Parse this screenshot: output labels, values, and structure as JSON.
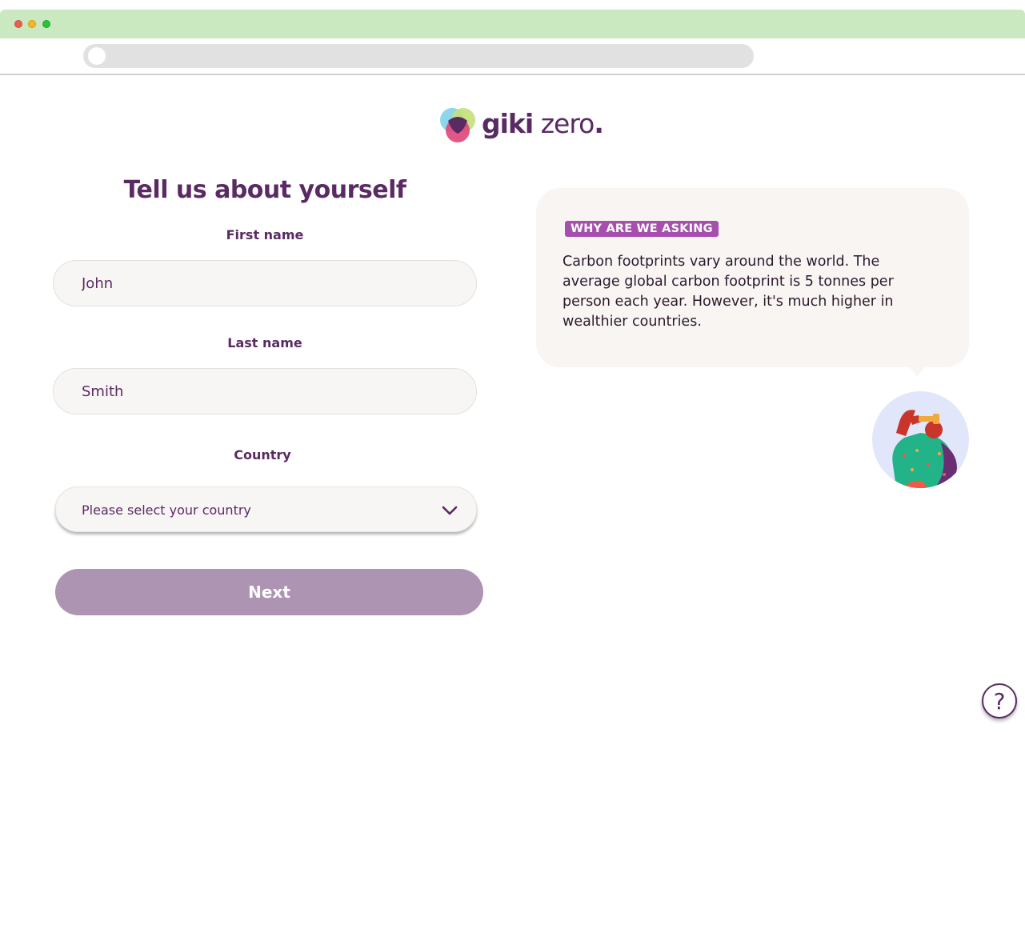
{
  "brand": {
    "name_bold": "giki",
    "name_light": "zero",
    "dot": "."
  },
  "form": {
    "title": "Tell us about yourself",
    "first_name_label": "First name",
    "first_name_value": "John",
    "last_name_label": "Last name",
    "last_name_value": "Smith",
    "country_label": "Country",
    "country_value": "Please select your country",
    "next_label": "Next"
  },
  "info": {
    "badge": "WHY ARE WE ASKING",
    "text": "Carbon footprints vary around the world. The average global carbon footprint is 5 tonnes per person each year. However, it's much higher in wealthier countries."
  },
  "help": {
    "icon": "question-icon",
    "glyph": "?"
  },
  "colors": {
    "brand_purple": "#5a2a63",
    "badge_purple": "#a64fae",
    "button_disabled": "#ae94b3",
    "chrome_green": "#cbe9c1"
  }
}
